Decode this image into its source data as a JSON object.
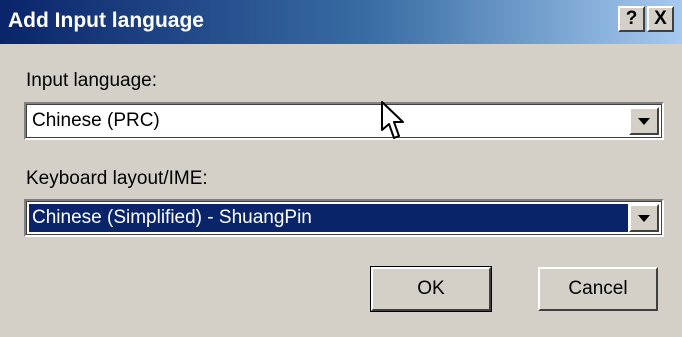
{
  "window": {
    "title": "Add Input language",
    "help_button": "?",
    "close_button": "X"
  },
  "input_language": {
    "label": "Input language:",
    "selected": "Chinese (PRC)"
  },
  "keyboard_layout": {
    "label": "Keyboard layout/IME:",
    "selected": "Chinese (Simplified) - ShuangPin"
  },
  "buttons": {
    "ok": "OK",
    "cancel": "Cancel"
  },
  "colors": {
    "title_bar_start": "#0a246a",
    "title_bar_end": "#a6caf0",
    "dialog_bg": "#d4d0c8",
    "selection": "#0a246a"
  },
  "icons": {
    "cursor": "mouse-pointer-icon",
    "dropdown": "chevron-down-icon"
  }
}
